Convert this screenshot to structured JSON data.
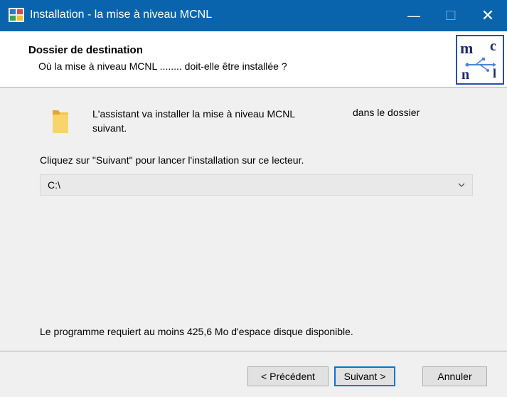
{
  "window": {
    "title": "Installation - la mise à niveau MCNL",
    "minimize": "—",
    "maximize": "☐",
    "close": "✕"
  },
  "header": {
    "title": "Dossier de destination",
    "subtitle": "Où la mise à niveau MCNL  ........  doit-elle être installée ?",
    "logo_letters": [
      "m",
      "c",
      "n",
      "l"
    ]
  },
  "content": {
    "intro_left_line1": "L'assistant va installer la mise à niveau MCNL",
    "intro_left_line2": "suivant.",
    "intro_right": "dans le dossier",
    "instruction": "Cliquez sur \"Suivant\" pour lancer l'installation sur ce lecteur.",
    "drive_value": "C:\\",
    "space_required": "Le programme requiert au moins 425,6 Mo d'espace disque disponible."
  },
  "buttons": {
    "previous": "< Précédent",
    "next": "Suivant >",
    "cancel": "Annuler"
  },
  "colors": {
    "titlebar": "#0a64ad",
    "accent_border": "#0078d7",
    "logo_blue": "#2a4db0",
    "folder": "#f3c64b"
  }
}
